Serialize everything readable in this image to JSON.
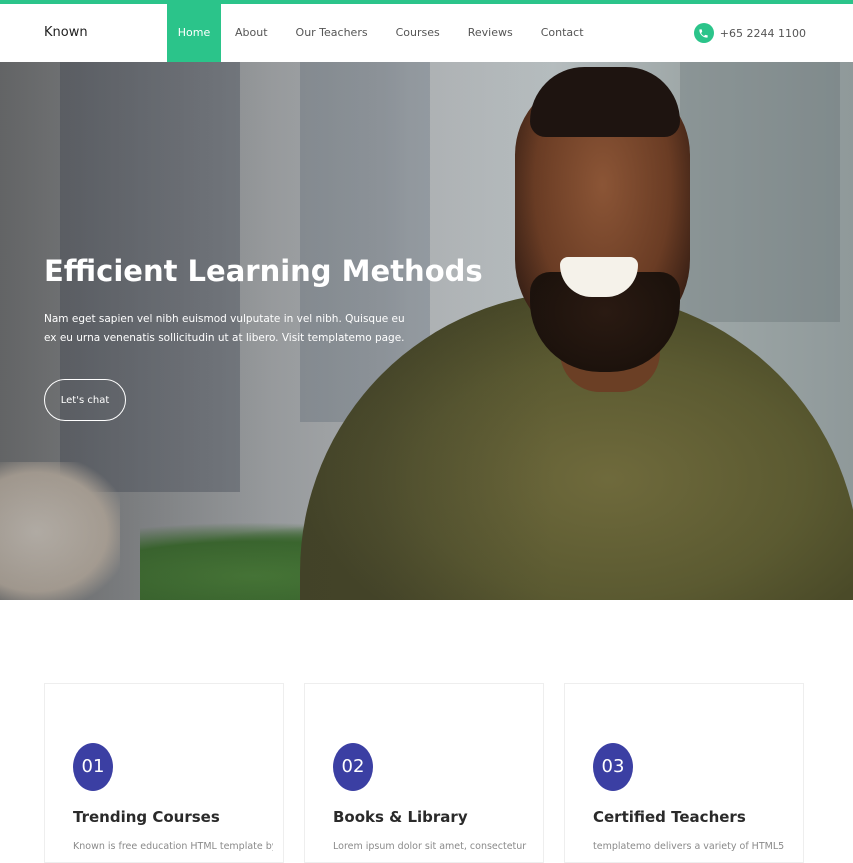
{
  "brand": "Known",
  "accent_color": "#2bc48a",
  "number_color": "#3b3fa3",
  "nav": {
    "items": [
      {
        "label": "Home",
        "active": true
      },
      {
        "label": "About",
        "active": false
      },
      {
        "label": "Our Teachers",
        "active": false
      },
      {
        "label": "Courses",
        "active": false
      },
      {
        "label": "Reviews",
        "active": false
      },
      {
        "label": "Contact",
        "active": false
      }
    ]
  },
  "contact": {
    "icon": "phone-icon",
    "phone": "+65 2244 1100"
  },
  "hero": {
    "title": "Efficient Learning Methods",
    "text": "Nam eget sapien vel nibh euismod vulputate in vel nibh. Quisque eu ex eu urna venenatis sollicitudin ut at libero. Visit templatemo page.",
    "button_label": "Let's chat"
  },
  "features": [
    {
      "number": "01",
      "title": "Trending Courses",
      "text": "Known is free education HTML template by"
    },
    {
      "number": "02",
      "title": "Books & Library",
      "text": "Lorem ipsum dolor sit amet, consectetur"
    },
    {
      "number": "03",
      "title": "Certified Teachers",
      "text": "templatemo delivers a variety of HTML5"
    }
  ]
}
